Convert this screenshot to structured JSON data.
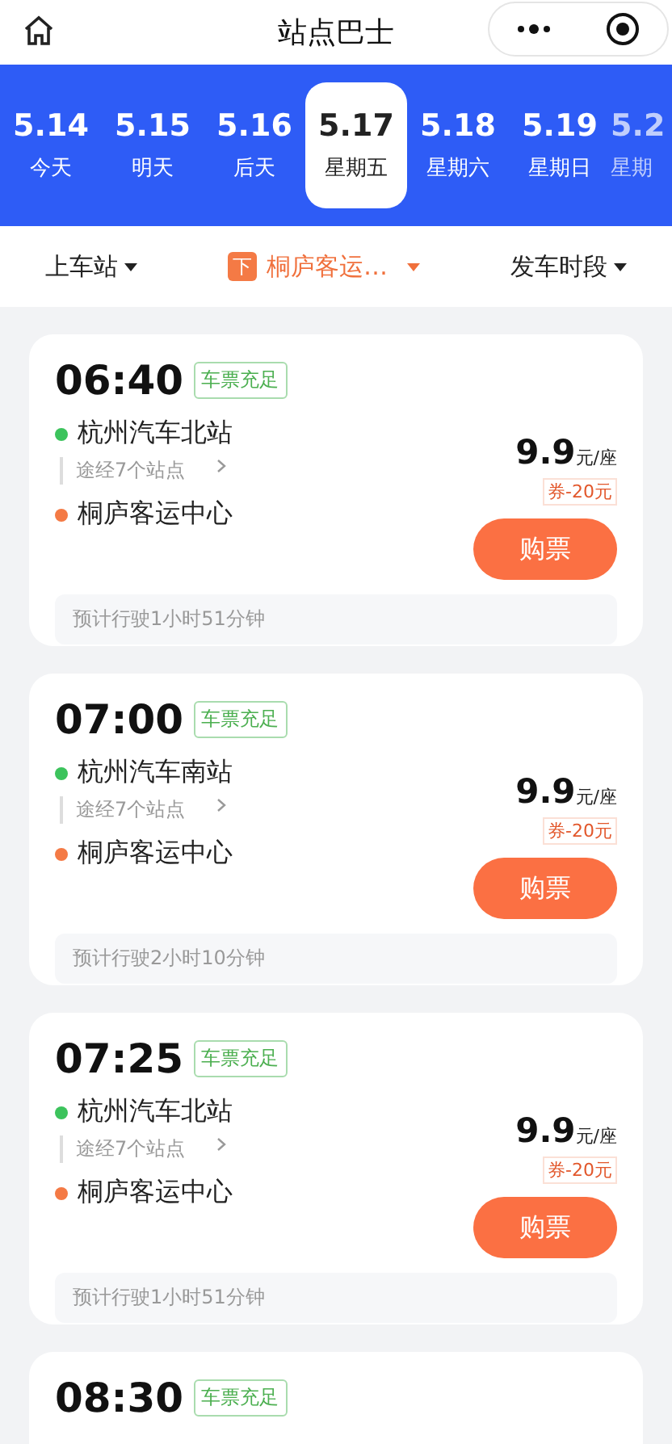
{
  "header": {
    "title": "站点巴士"
  },
  "dates": [
    {
      "date": "5.14",
      "day": "今天",
      "selected": false
    },
    {
      "date": "5.15",
      "day": "明天",
      "selected": false
    },
    {
      "date": "5.16",
      "day": "后天",
      "selected": false
    },
    {
      "date": "5.17",
      "day": "星期五",
      "selected": true
    },
    {
      "date": "5.18",
      "day": "星期六",
      "selected": false
    },
    {
      "date": "5.19",
      "day": "星期日",
      "selected": false
    },
    {
      "date": "5.2",
      "day": "星期",
      "selected": false,
      "cut": true
    }
  ],
  "filters": [
    {
      "label": "上车站",
      "active": false
    },
    {
      "label": "桐庐客运…",
      "active": true,
      "badge": "下"
    },
    {
      "label": "发车时段",
      "active": false
    }
  ],
  "trips": [
    {
      "time": "06:40",
      "status": "车票充足",
      "from": "杭州汽车北站",
      "via": "途经7个站点",
      "to": "桐庐客运中心",
      "price": "9.9",
      "unit": "元/座",
      "coupon": "券-20元",
      "button": "购票",
      "duration": "预计行驶1小时51分钟"
    },
    {
      "time": "07:00",
      "status": "车票充足",
      "from": "杭州汽车南站",
      "via": "途经7个站点",
      "to": "桐庐客运中心",
      "price": "9.9",
      "unit": "元/座",
      "coupon": "券-20元",
      "button": "购票",
      "duration": "预计行驶2小时10分钟"
    },
    {
      "time": "07:25",
      "status": "车票充足",
      "from": "杭州汽车北站",
      "via": "途经7个站点",
      "to": "桐庐客运中心",
      "price": "9.9",
      "unit": "元/座",
      "coupon": "券-20元",
      "button": "购票",
      "duration": "预计行驶1小时51分钟"
    },
    {
      "time": "08:30",
      "status": "车票充足"
    }
  ]
}
